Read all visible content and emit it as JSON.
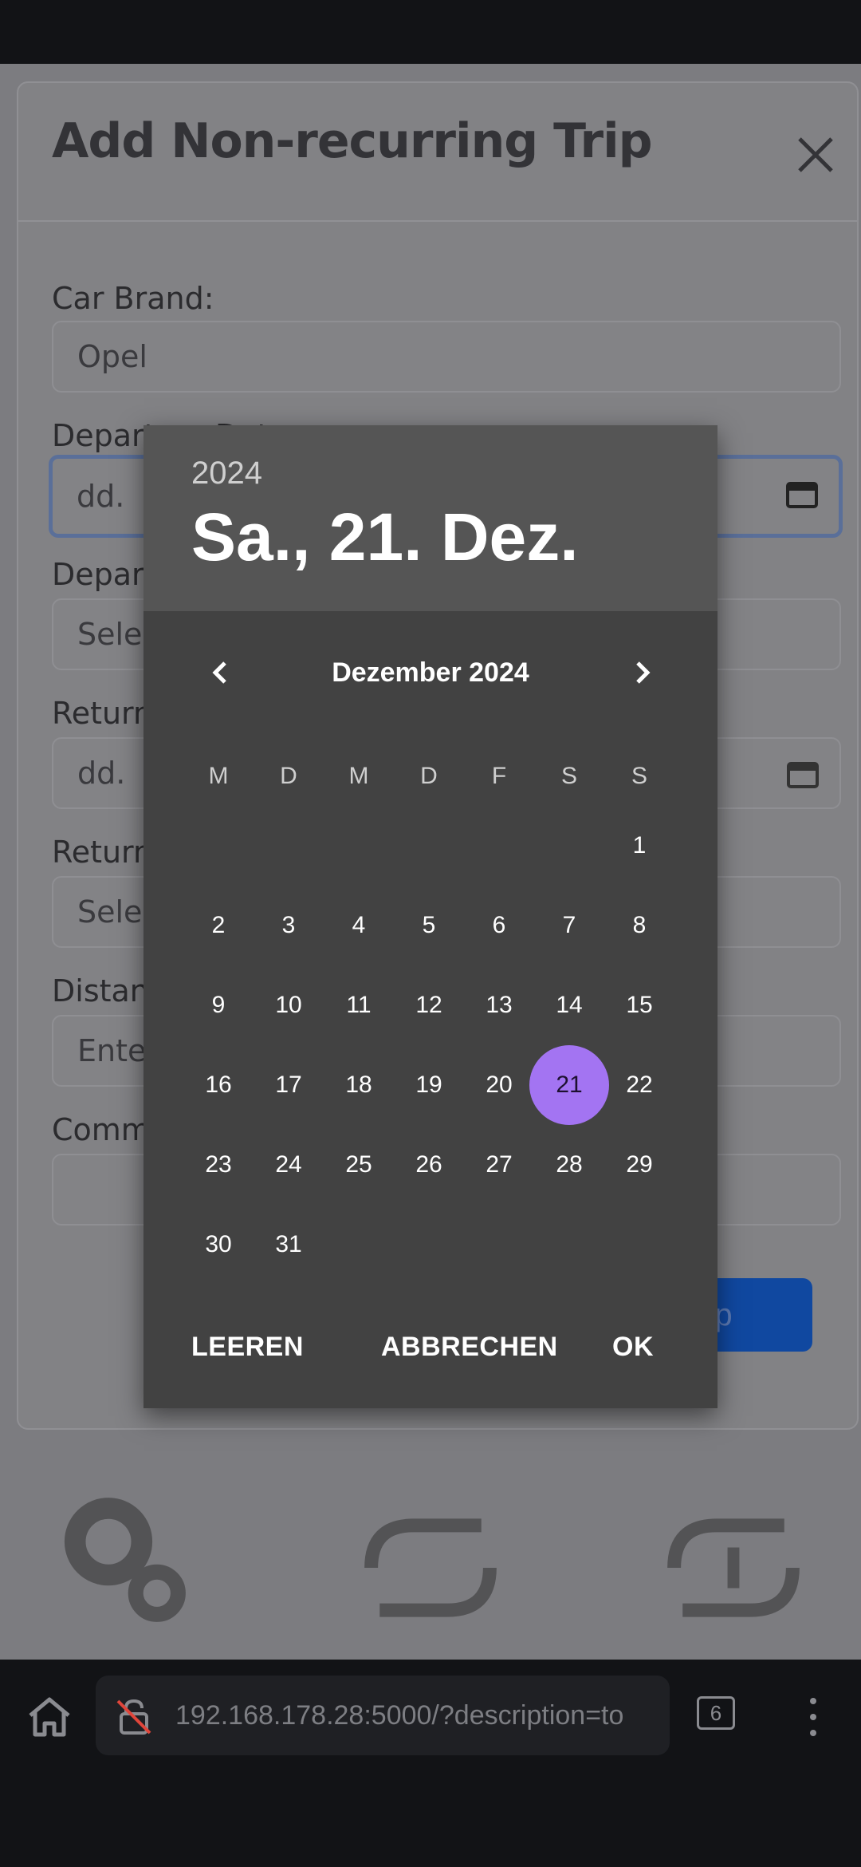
{
  "modal": {
    "title": "Add Non-recurring Trip",
    "fields": [
      {
        "label": "Car Brand:",
        "value": "Opel"
      },
      {
        "label": "Departure Date:",
        "value": "dd."
      },
      {
        "label": "Depar",
        "value": "Sele"
      },
      {
        "label": "Return",
        "value": "dd."
      },
      {
        "label": "Return",
        "value": "Sele"
      },
      {
        "label": "Distan",
        "value": "Ente"
      },
      {
        "label": "Comm",
        "value": ""
      }
    ],
    "submit_label": "trip"
  },
  "picker": {
    "year": "2024",
    "selected_date": "Sa., 21. Dez.",
    "month_label": "Dezember 2024",
    "weekdays": [
      "M",
      "D",
      "M",
      "D",
      "F",
      "S",
      "S"
    ],
    "days": [
      "1",
      "2",
      "3",
      "4",
      "5",
      "6",
      "7",
      "8",
      "9",
      "10",
      "11",
      "12",
      "13",
      "14",
      "15",
      "16",
      "17",
      "18",
      "19",
      "20",
      "21",
      "22",
      "23",
      "24",
      "25",
      "26",
      "27",
      "28",
      "29",
      "30",
      "31"
    ],
    "selected_day": "21",
    "accent": "#a374f2",
    "actions": {
      "clear": "LEEREN",
      "cancel": "ABBRECHEN",
      "ok": "OK"
    }
  },
  "browser": {
    "url": "192.168.178.28:5000/?description=to",
    "tab_count": "6"
  },
  "icons": {
    "close": "close-icon",
    "calendar": "calendar-icon",
    "prev": "chevron-left-icon",
    "next": "chevron-right-icon",
    "home": "home-icon",
    "lock": "lock-off-icon",
    "menu": "more-vert-icon"
  }
}
